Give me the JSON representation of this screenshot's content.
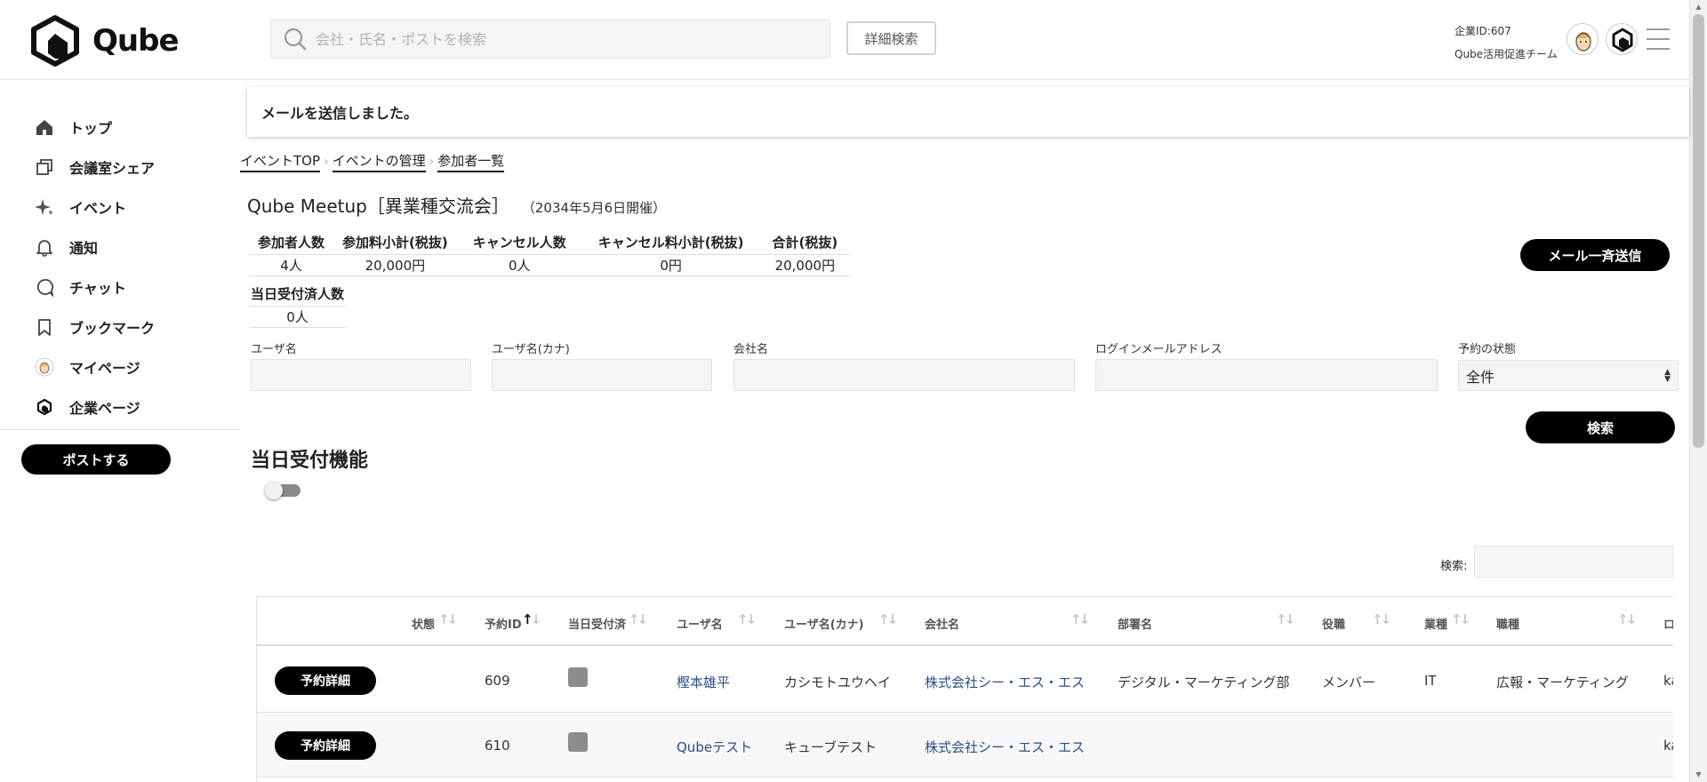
{
  "header": {
    "logo_text": "Qube",
    "search_placeholder": "会社・氏名・ポストを検索",
    "advanced_search_label": "詳細検索",
    "company_id": "企業ID:607",
    "team_name": "Qube活用促進チーム"
  },
  "sidebar": {
    "items": [
      {
        "label": "トップ",
        "icon": "home-icon"
      },
      {
        "label": "会議室シェア",
        "icon": "room-share-icon"
      },
      {
        "label": "イベント",
        "icon": "sparkle-icon"
      },
      {
        "label": "通知",
        "icon": "bell-icon"
      },
      {
        "label": "チャット",
        "icon": "chat-icon"
      },
      {
        "label": "ブックマーク",
        "icon": "bookmark-icon"
      },
      {
        "label": "マイページ",
        "icon": "user-avatar-icon"
      },
      {
        "label": "企業ページ",
        "icon": "company-logo-icon"
      }
    ],
    "post_button": "ポストする"
  },
  "toast": {
    "message": "メールを送信しました。"
  },
  "breadcrumb": [
    "イベントTOP",
    "イベントの管理",
    "参加者一覧"
  ],
  "event": {
    "title": "Qube Meetup［異業種交流会］",
    "date": "（2034年5月6日開催）"
  },
  "summary": {
    "headers": [
      "参加者人数",
      "参加料小計(税抜)",
      "キャンセル人数",
      "キャンセル料小計(税抜)",
      "合計(税抜)"
    ],
    "values": [
      "4人",
      "20,000円",
      "0人",
      "0円",
      "20,000円"
    ],
    "checkin_header": "当日受付済人数",
    "checkin_value": "0人"
  },
  "mail_all_button": "メール一斉送信",
  "filters": {
    "user_name": "ユーザ名",
    "user_name_kana": "ユーザ名(カナ)",
    "company_name": "会社名",
    "login_email": "ログインメールアドレス",
    "reservation_status": "予約の状態",
    "reservation_status_value": "全件",
    "search_button": "検索"
  },
  "checkin_feature": {
    "title": "当日受付機能",
    "enabled": false
  },
  "table": {
    "search_label": "検索:",
    "columns": [
      "状態",
      "予約ID",
      "当日受付済",
      "ユーザ名",
      "ユーザ名(カナ)",
      "会社名",
      "部署名",
      "役職",
      "業種",
      "職種",
      "ロ"
    ],
    "detail_button": "予約詳細",
    "rows": [
      {
        "id": "609",
        "checked_in": true,
        "user_name": "樫本雄平",
        "user_kana": "カシモトユウヘイ",
        "company": "株式会社シー・エス・エス",
        "department": "デジタル・マーケティング部",
        "position": "メンバー",
        "industry": "IT",
        "occupation": "広報・マーケティング",
        "login": "ka"
      },
      {
        "id": "610",
        "checked_in": true,
        "user_name": "Qubeテスト",
        "user_kana": "キューブテスト",
        "company": "株式会社シー・エス・エス",
        "department": "",
        "position": "",
        "industry": "",
        "occupation": "",
        "login": "ka"
      }
    ]
  },
  "colors": {
    "primary_button": "#000000",
    "link": "#2b4f83",
    "input_background": "#f5f5f5"
  }
}
